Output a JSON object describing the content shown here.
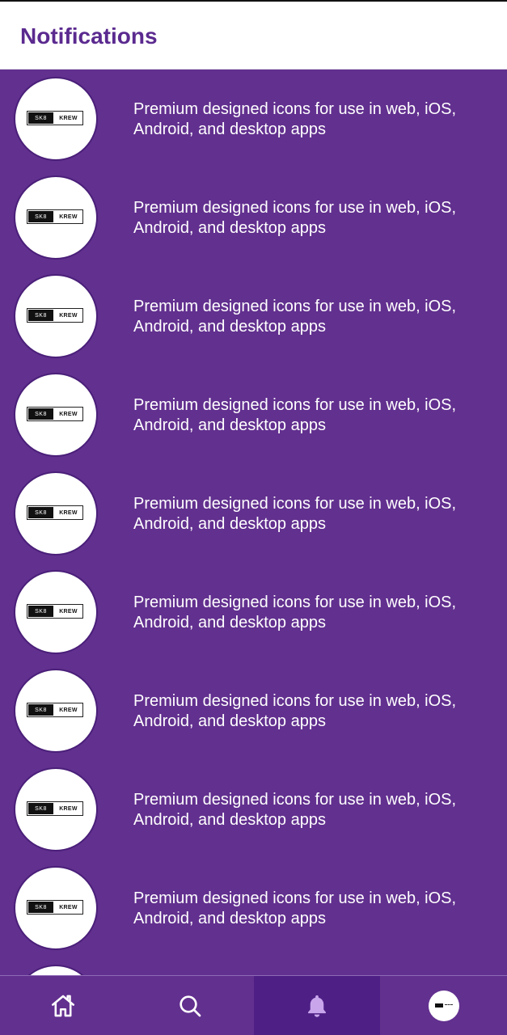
{
  "header": {
    "title": "Notifications"
  },
  "notifications": [
    {
      "logo_left": "SK8",
      "logo_right": "KREW",
      "message": "Premium designed icons for use in web, iOS, Android, and desktop apps"
    },
    {
      "logo_left": "SK8",
      "logo_right": "KREW",
      "message": "Premium designed icons for use in web, iOS, Android, and desktop apps"
    },
    {
      "logo_left": "SK8",
      "logo_right": "KREW",
      "message": "Premium designed icons for use in web, iOS, Android, and desktop apps"
    },
    {
      "logo_left": "SK8",
      "logo_right": "KREW",
      "message": "Premium designed icons for use in web, iOS, Android, and desktop apps"
    },
    {
      "logo_left": "SK8",
      "logo_right": "KREW",
      "message": "Premium designed icons for use in web, iOS, Android, and desktop apps"
    },
    {
      "logo_left": "SK8",
      "logo_right": "KREW",
      "message": "Premium designed icons for use in web, iOS, Android, and desktop apps"
    },
    {
      "logo_left": "SK8",
      "logo_right": "KREW",
      "message": "Premium designed icons for use in web, iOS, Android, and desktop apps"
    },
    {
      "logo_left": "SK8",
      "logo_right": "KREW",
      "message": "Premium designed icons for use in web, iOS, Android, and desktop apps"
    },
    {
      "logo_left": "SK8",
      "logo_right": "KREW",
      "message": "Premium designed icons for use in web, iOS, Android, and desktop apps"
    }
  ],
  "navbar": {
    "items": [
      {
        "icon": "home-icon",
        "active": false
      },
      {
        "icon": "search-icon",
        "active": false
      },
      {
        "icon": "bell-icon",
        "active": true
      },
      {
        "icon": "profile-avatar",
        "active": false
      }
    ]
  },
  "colors": {
    "background": "#62308f",
    "title": "#5b2a8f",
    "active_tab": "#4e1f85",
    "bell_active": "#c9a6ec"
  }
}
